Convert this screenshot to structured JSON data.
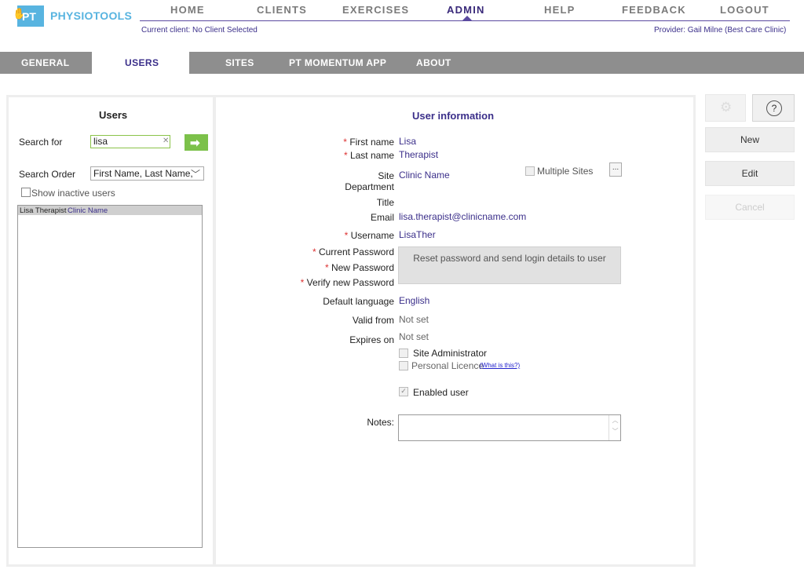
{
  "brand": {
    "logo_mark": "PT",
    "name": "PHYSIOTOOLS"
  },
  "nav": {
    "items": [
      "HOME",
      "CLIENTS",
      "EXERCISES",
      "ADMIN",
      "HELP",
      "FEEDBACK",
      "LOGOUT"
    ],
    "active": "ADMIN"
  },
  "status": {
    "current_client": "Current client: No Client Selected",
    "provider": "Provider: Gail Milne (Best Care Clinic)"
  },
  "subtabs": [
    "GENERAL",
    "USERS",
    "SITES",
    "PT MOMENTUM APP",
    "ABOUT"
  ],
  "active_subtab": "USERS",
  "left": {
    "heading": "Users",
    "search_label": "Search for",
    "search_value": "lisa",
    "order_label": "Search Order",
    "order_value": "First Name, Last Name,",
    "show_inactive": "Show inactive users",
    "results": [
      {
        "name": "Lisa Therapist",
        "site": "Clinic Name"
      }
    ]
  },
  "form": {
    "heading": "User information",
    "first_name_label": "First name",
    "first_name": "Lisa",
    "last_name_label": "Last name",
    "last_name": "Therapist",
    "site_label": "Site",
    "site": "Clinic Name",
    "multiple_sites": "Multiple Sites",
    "dots": "...",
    "department_label": "Department",
    "title_label": "Title",
    "email_label": "Email",
    "email": "lisa.therapist@clinicname.com",
    "username_label": "Username",
    "username": "LisaTher",
    "current_password_label": "Current Password",
    "new_password_label": "New Password",
    "verify_password_label": "Verify new Password",
    "reset_button": "Reset password and send login details to user",
    "language_label": "Default language",
    "language": "English",
    "valid_from_label": "Valid from",
    "valid_from": "Not set",
    "expires_on_label": "Expires on",
    "expires_on": "Not set",
    "site_admin": "Site Administrator",
    "personal_licence": "Personal Licence",
    "what_is_this": "(What is this?)",
    "enabled_user": "Enabled user",
    "notes_label": "Notes:",
    "required_mark": "*"
  },
  "actions": {
    "new": "New",
    "edit": "Edit",
    "cancel": "Cancel",
    "help": "?"
  },
  "colors": {
    "accent": "#3b2f8a",
    "brand": "#58b4e0",
    "go": "#7cc14a"
  }
}
